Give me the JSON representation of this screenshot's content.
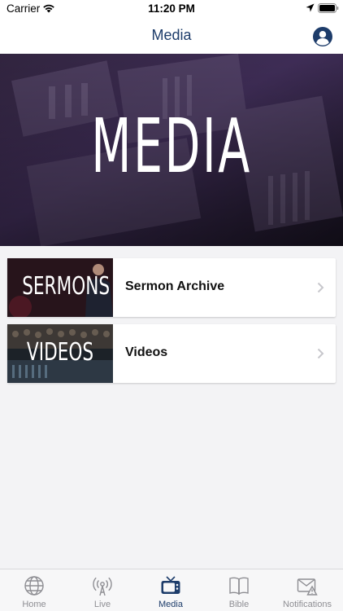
{
  "status_bar": {
    "carrier": "Carrier",
    "time": "11:20 PM"
  },
  "nav": {
    "title": "Media"
  },
  "hero": {
    "title": "MEDIA"
  },
  "media_items": [
    {
      "thumb_text": "SERMONS",
      "label": "Sermon Archive"
    },
    {
      "thumb_text": "VIDEOS",
      "label": "Videos"
    }
  ],
  "tabs": [
    {
      "label": "Home",
      "icon": "globe-icon",
      "active": false
    },
    {
      "label": "Live",
      "icon": "broadcast-icon",
      "active": false
    },
    {
      "label": "Media",
      "icon": "tv-icon",
      "active": true
    },
    {
      "label": "Bible",
      "icon": "book-icon",
      "active": false
    },
    {
      "label": "Notifications",
      "icon": "mail-alert-icon",
      "active": false
    }
  ],
  "colors": {
    "accent": "#1d3c6a",
    "inactive": "#8e8e93",
    "background": "#f3f3f5"
  }
}
